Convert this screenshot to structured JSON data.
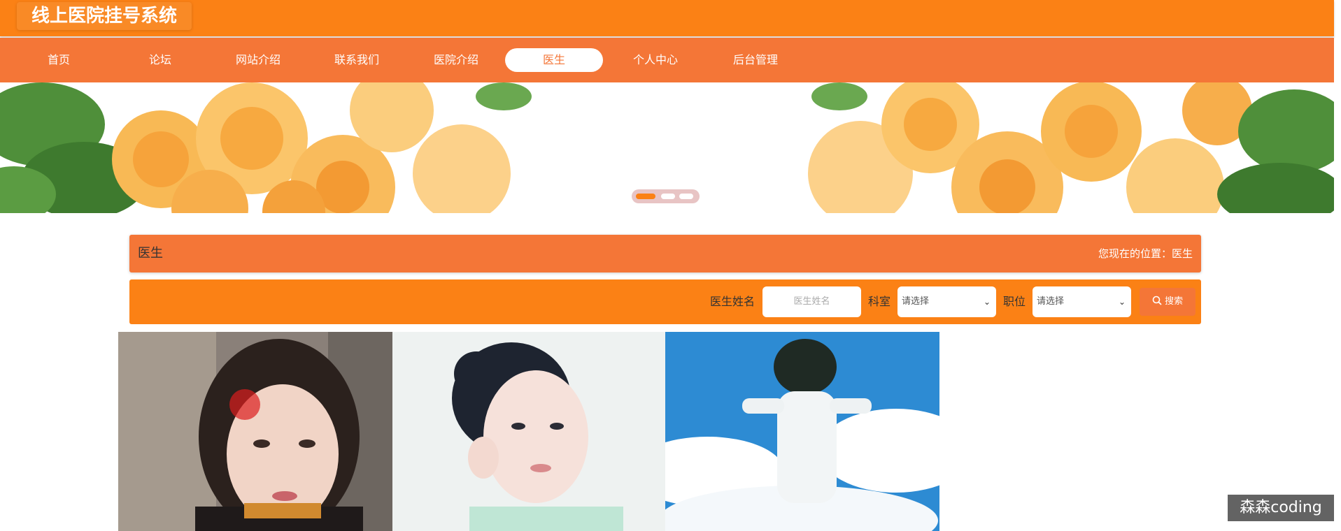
{
  "header": {
    "site_title": "线上医院挂号系统"
  },
  "nav": {
    "items": [
      {
        "label": "首页"
      },
      {
        "label": "论坛"
      },
      {
        "label": "网站介绍"
      },
      {
        "label": "联系我们"
      },
      {
        "label": "医院介绍"
      },
      {
        "label": "医生",
        "active": true
      },
      {
        "label": "个人中心"
      },
      {
        "label": "后台管理"
      }
    ]
  },
  "banner": {
    "active_slide": 1,
    "slide_count": 3
  },
  "section": {
    "title": "医生",
    "breadcrumb": "您现在的位置：医生"
  },
  "search": {
    "name_label": "医生姓名",
    "name_placeholder": "医生姓名",
    "dept_label": "科室",
    "dept_value": "请选择",
    "position_label": "职位",
    "position_value": "请选择",
    "button_label": "搜索"
  },
  "watermark": "森森coding",
  "colors": {
    "header": "#fb8115",
    "nav": "#f47637",
    "accent": "#f47637"
  }
}
